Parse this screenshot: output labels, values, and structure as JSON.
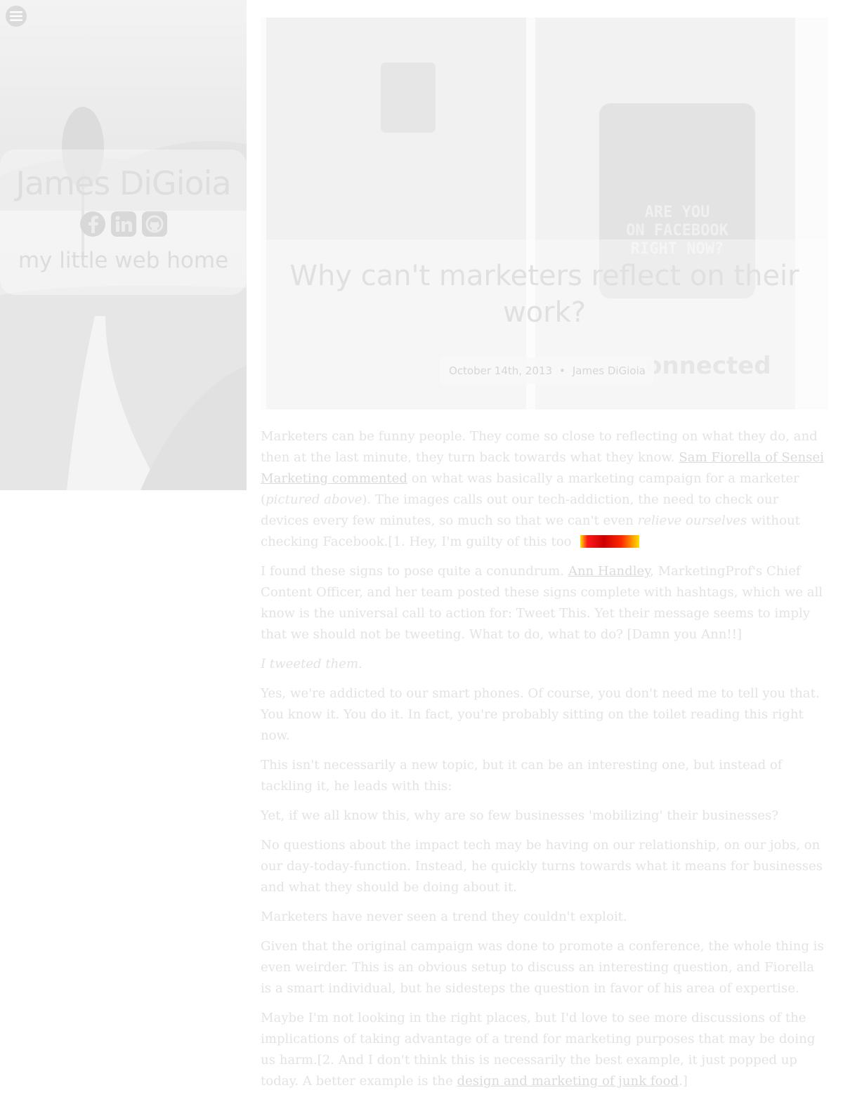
{
  "sidebar": {
    "name": "James DiGioia",
    "tagline": "my little web home",
    "social": [
      {
        "icon": "facebook-icon"
      },
      {
        "icon": "linkedin-icon"
      },
      {
        "icon": "github-icon"
      }
    ]
  },
  "hero": {
    "sign_text": [
      "ARE YOU",
      "ON FACEBOOK",
      "RIGHT NOW?"
    ],
    "watermark": "onnected"
  },
  "post": {
    "title": "Why can't marketers reflect on their work?",
    "date": "October 14th, 2013",
    "separator": "•",
    "author": "James DiGioia"
  },
  "article": {
    "p1": {
      "t1": "Marketers can be funny people. They come so close to reflecting on what they do, and then at the last minute, they turn back towards what they know. ",
      "link1": "Sam Fiorella of Sensei Marketing commented",
      "t2": " on what was basically a marketing campaign for a marketer (",
      "em1": "pictured above",
      "t3": "). The images calls out our tech-addiction, the need to check our devices every few minutes, so much so that we can't even ",
      "em2": "relieve ourselves",
      "t4": " without checking Facebook.[1. Hey, I'm guilty of this too"
    },
    "p2": {
      "t1": "I found these signs to pose quite a conundrum. ",
      "link1": "Ann Handley",
      "t2": ", MarketingProf's Chief Content Officer, and her team posted these signs complete with hashtags, which we all know is the universal call to action for: Tweet This. Yet their message seems to imply that we should not be tweeting. What to do, what to do? [Damn you Ann!!]"
    },
    "p3": "I tweeted them.",
    "p4": "Yes, we're addicted to our smart phones. Of course, you don't need me to tell you that. You know it. You do it. In fact, you're probably sitting on the toilet reading this right now.",
    "p5": "This isn't necessarily a new topic, but it can be an interesting one, but instead of tackling it, he leads with this:",
    "p6": "Yet, if we all know this, why are so few businesses 'mobilizing' their businesses?",
    "p7": "No questions about the impact tech may be having on our relationship, on our jobs, on our day-today-function. Instead, he quickly turns towards what it means for businesses and what they should be doing about it.",
    "p8": "Marketers have never seen a trend they couldn't exploit.",
    "p9": "Given that the original campaign was done to promote a conference, the whole thing is even weirder. This is an obvious setup to discuss an interesting question, and Fiorella is a smart individual, but he sidesteps the question in favor of his area of expertise.",
    "p10": {
      "t1": "Maybe I'm not looking in the right places, but I'd love to see more discussions of the implications of taking advantage of a trend for marketing purposes that may be doing us harm.[2. And I don't think this is necessarily the best example, it just popped up today. A better example is the ",
      "link1": "design and marketing of junk food",
      "t2": ".]"
    }
  }
}
